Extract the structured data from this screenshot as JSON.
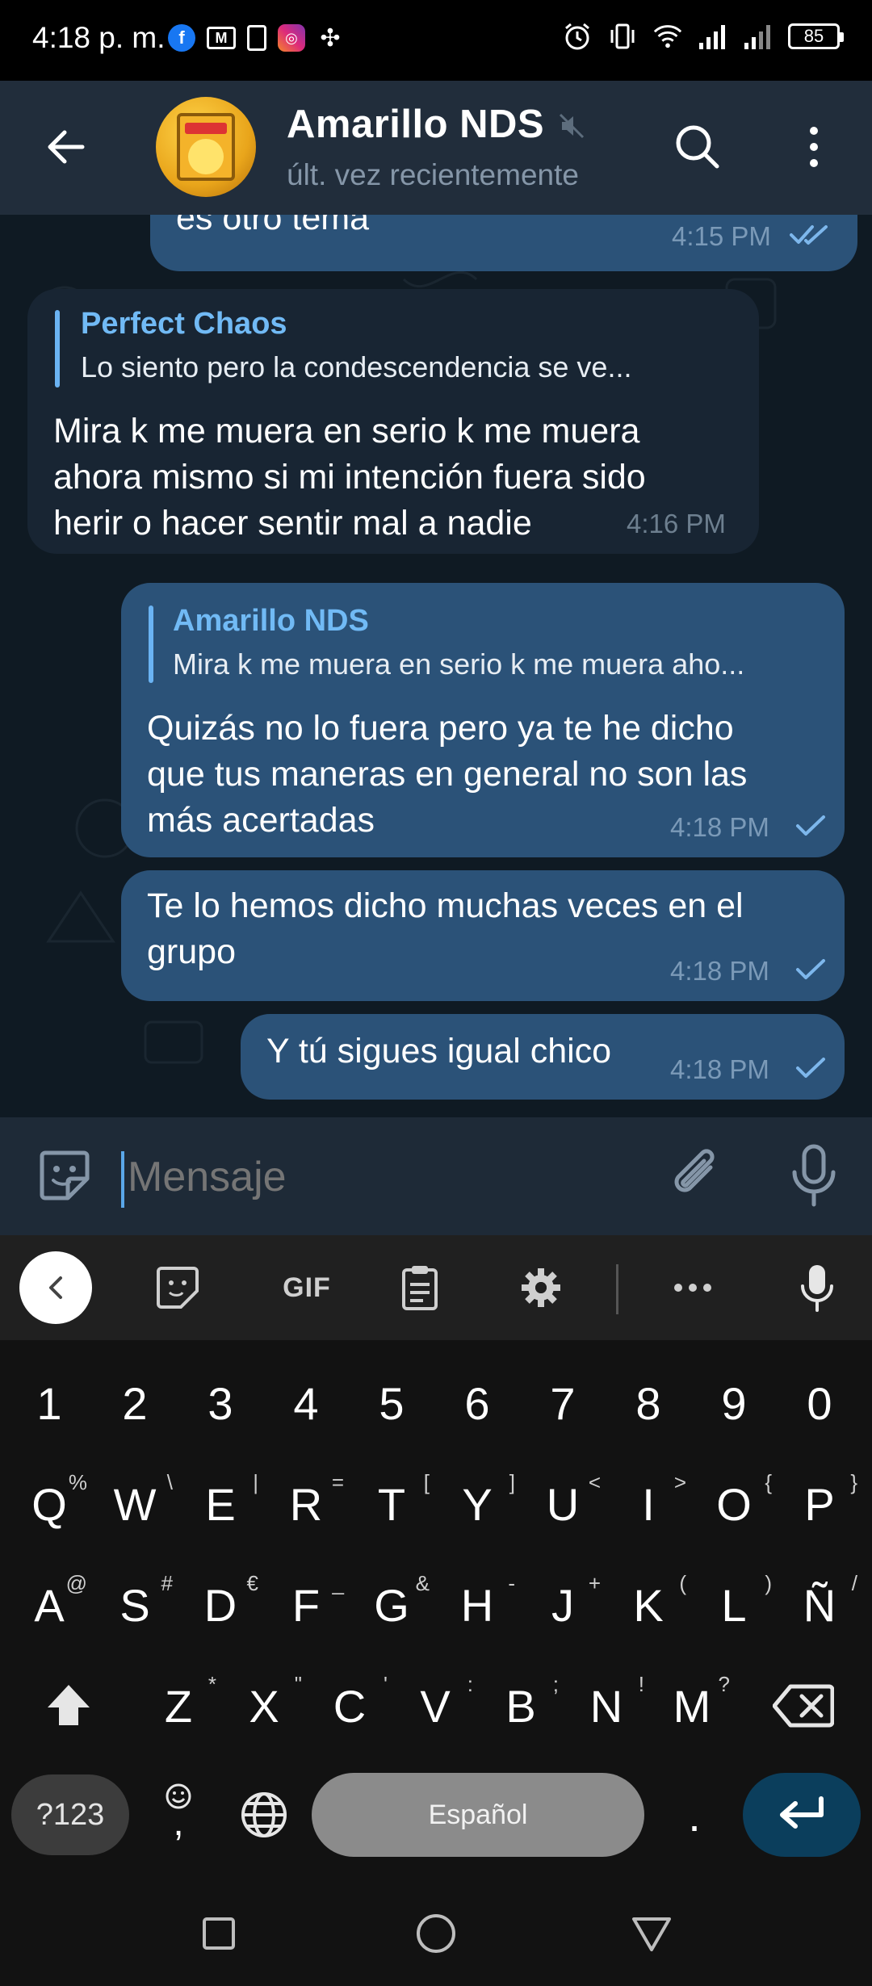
{
  "status_bar": {
    "time": "4:18 p. m.",
    "battery": "85",
    "icons_left": [
      "facebook-icon",
      "gmail-icon",
      "document-icon",
      "instagram-icon",
      "pinwheel-icon"
    ],
    "icons_right": [
      "alarm-icon",
      "vibrate-icon",
      "wifi-icon",
      "signal-icon",
      "signal-icon-2",
      "battery-icon"
    ]
  },
  "header": {
    "title": "Amarillo NDS",
    "subtitle": "últ. vez recientemente",
    "accent": "#212d3b"
  },
  "messages": [
    {
      "id": "m1",
      "direction": "out",
      "text": "es otro tema",
      "time": "4:15 PM",
      "status": "read"
    },
    {
      "id": "m2",
      "direction": "in",
      "reply_name": "Perfect Chaos",
      "reply_text": "Lo siento pero la condescendencia se ve...",
      "lines": [
        "Mira k me muera en serio k me muera",
        "ahora mismo si mi intención fuera sido",
        "herir o hacer sentir mal a nadie"
      ],
      "time": "4:16 PM"
    },
    {
      "id": "m3",
      "direction": "out",
      "reply_name": "Amarillo NDS",
      "reply_text": "Mira k me muera en serio k me muera aho...",
      "lines": [
        "Quizás no lo fuera pero ya te he dicho",
        "que tus maneras en general no son las",
        "más acertadas"
      ],
      "time": "4:18 PM",
      "status": "sent"
    },
    {
      "id": "m4",
      "direction": "out",
      "lines": [
        "Te lo hemos dicho muchas veces en el",
        "grupo"
      ],
      "time": "4:18 PM",
      "status": "sent"
    },
    {
      "id": "m5",
      "direction": "out",
      "text": "Y tú sigues igual chico",
      "time": "4:18 PM",
      "status": "sent"
    }
  ],
  "input": {
    "placeholder": "Mensaje"
  },
  "keyboard": {
    "toolbar": {
      "gif": "GIF"
    },
    "numbers": [
      "1",
      "2",
      "3",
      "4",
      "5",
      "6",
      "7",
      "8",
      "9",
      "0"
    ],
    "row1": [
      [
        "Q",
        "%"
      ],
      [
        "W",
        "\\"
      ],
      [
        "E",
        "|"
      ],
      [
        "R",
        "="
      ],
      [
        "T",
        "["
      ],
      [
        "Y",
        "]"
      ],
      [
        "U",
        "<"
      ],
      [
        "I",
        ">"
      ],
      [
        "O",
        "{"
      ],
      [
        "P",
        "}"
      ]
    ],
    "row2": [
      [
        "A",
        "@"
      ],
      [
        "S",
        "#"
      ],
      [
        "D",
        "€"
      ],
      [
        "F",
        "_"
      ],
      [
        "G",
        "&"
      ],
      [
        "H",
        "-"
      ],
      [
        "J",
        "+"
      ],
      [
        "K",
        "("
      ],
      [
        "L",
        ")"
      ],
      [
        "Ñ",
        "/"
      ]
    ],
    "row3": [
      [
        "Z",
        "*"
      ],
      [
        "X",
        "\""
      ],
      [
        "C",
        "'"
      ],
      [
        "V",
        ":"
      ],
      [
        "B",
        ";"
      ],
      [
        "N",
        "!"
      ],
      [
        "M",
        "?"
      ]
    ],
    "sym": "?123",
    "comma": ",",
    "space": "Español",
    "period": "."
  },
  "colors": {
    "bubble_out": "#2b5278",
    "bubble_in": "#182533",
    "chat_bg": "#0f1a23",
    "link": "#71baf5",
    "enter_key": "#0b3e5c"
  }
}
